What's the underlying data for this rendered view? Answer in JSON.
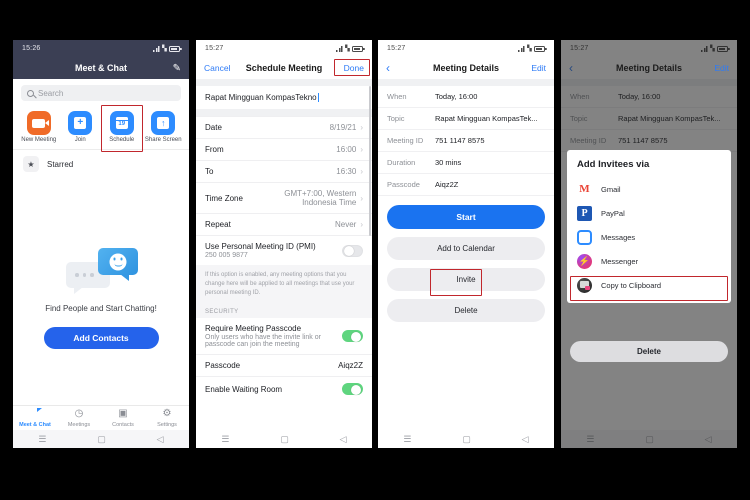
{
  "phone1": {
    "status": {
      "time": "15:26"
    },
    "nav": {
      "title": "Meet & Chat",
      "compose_icon": "compose-icon"
    },
    "search": {
      "placeholder": "Search",
      "icon": "search-icon"
    },
    "actions": [
      {
        "label": "New Meeting",
        "icon": "video-camera-icon",
        "color": "#f06b28"
      },
      {
        "label": "Join",
        "icon": "plus-square-icon",
        "color": "#2d8cff"
      },
      {
        "label": "Schedule",
        "icon": "calendar-icon",
        "color": "#2d8cff"
      },
      {
        "label": "Share Screen",
        "icon": "share-screen-icon",
        "color": "#2d8cff"
      }
    ],
    "highlight_color": "#c1272d",
    "starred": {
      "label": "Starred",
      "icon": "star-icon"
    },
    "empty": {
      "text": "Find People and Start Chatting!",
      "button": "Add Contacts"
    },
    "tabs": [
      {
        "label": "Meet & Chat",
        "icon": "chat-bubble-icon",
        "active": true
      },
      {
        "label": "Meetings",
        "icon": "clock-icon",
        "active": false
      },
      {
        "label": "Contacts",
        "icon": "contacts-icon",
        "active": false
      },
      {
        "label": "Settings",
        "icon": "gear-icon",
        "active": false
      }
    ],
    "sysnav": {
      "menu": "☰",
      "home": "▢",
      "back": "◁"
    }
  },
  "phone2": {
    "status": {
      "time": "15:27"
    },
    "nav": {
      "left": "Cancel",
      "title": "Schedule Meeting",
      "right": "Done"
    },
    "topic": "Rapat Mingguan KompasTekno",
    "rows": [
      {
        "label": "Date",
        "value": "8/19/21",
        "chevron": true
      },
      {
        "label": "From",
        "value": "16:00",
        "chevron": true
      },
      {
        "label": "To",
        "value": "16:30",
        "chevron": true
      },
      {
        "label": "Time Zone",
        "value": "GMT+7:00, Western Indonesia Time",
        "chevron": true
      },
      {
        "label": "Repeat",
        "value": "Never",
        "chevron": true
      }
    ],
    "pmi": {
      "label": "Use Personal Meeting ID (PMI)",
      "sub": "250 005 9877",
      "toggle": "off"
    },
    "note": "If this option is enabled, any meeting options that you change here will be applied to all meetings that use your personal meeting ID.",
    "security_header": "SECURITY",
    "passcode_row": {
      "label": "Require Meeting Passcode",
      "sub": "Only users who have the invite link or passcode can join the meeting",
      "toggle": "on"
    },
    "passcode": {
      "label": "Passcode",
      "value": "Aiqz2Z"
    },
    "waiting_room": {
      "label": "Enable Waiting Room",
      "toggle": "on"
    }
  },
  "phone3": {
    "status": {
      "time": "15:27"
    },
    "nav": {
      "back_icon": "chevron-left-icon",
      "title": "Meeting Details",
      "right": "Edit"
    },
    "details": [
      {
        "label": "When",
        "value": "Today, 16:00"
      },
      {
        "label": "Topic",
        "value": "Rapat Mingguan KompasTek..."
      },
      {
        "label": "Meeting ID",
        "value": "751 1147 8575"
      },
      {
        "label": "Duration",
        "value": "30 mins"
      },
      {
        "label": "Passcode",
        "value": "Aiqz2Z"
      }
    ],
    "buttons": [
      {
        "label": "Start",
        "style": "primary"
      },
      {
        "label": "Add to Calendar",
        "style": "secondary"
      },
      {
        "label": "Invite",
        "style": "secondary",
        "highlighted": true
      },
      {
        "label": "Delete",
        "style": "secondary"
      }
    ]
  },
  "phone4": {
    "status": {
      "time": "15:27"
    },
    "nav": {
      "back_icon": "chevron-left-icon",
      "title": "Meeting Details",
      "right": "Edit"
    },
    "details": [
      {
        "label": "When",
        "value": "Today, 16:00"
      },
      {
        "label": "Topic",
        "value": "Rapat Mingguan KompasTek..."
      },
      {
        "label": "Meeting ID",
        "value": "751 1147 8575"
      }
    ],
    "sheet": {
      "title": "Add Invitees via",
      "items": [
        {
          "label": "Gmail",
          "icon": "gmail-icon"
        },
        {
          "label": "PayPal",
          "icon": "paypal-icon"
        },
        {
          "label": "Messages",
          "icon": "messages-icon"
        },
        {
          "label": "Messenger",
          "icon": "messenger-icon"
        },
        {
          "label": "Copy to Clipboard",
          "icon": "clipboard-icon",
          "highlighted": true
        }
      ]
    },
    "delete_button": "Delete"
  }
}
